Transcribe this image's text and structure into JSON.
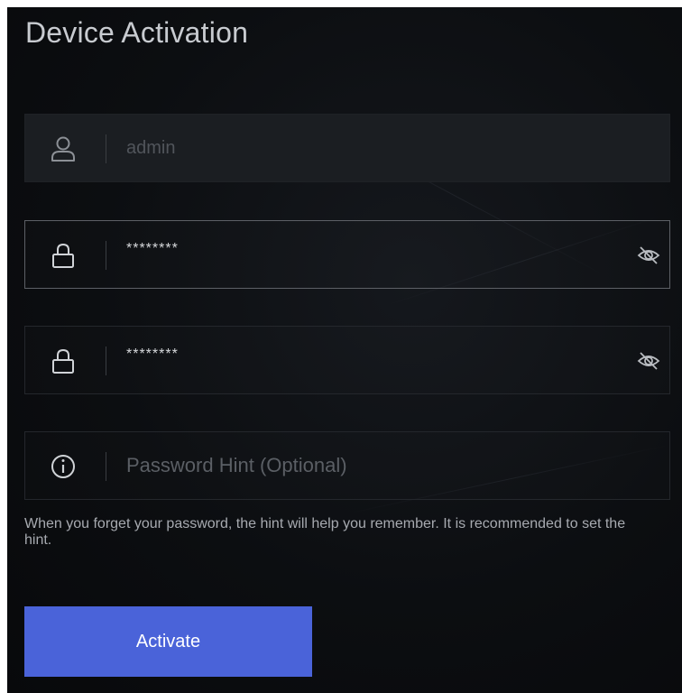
{
  "title": "Device Activation",
  "fields": {
    "username": {
      "value": "admin",
      "icon": "user-icon"
    },
    "password": {
      "value": "********",
      "icon": "lock-icon",
      "toggle_icon": "eye-off-icon"
    },
    "confirm_password": {
      "value": "********",
      "icon": "lock-icon",
      "toggle_icon": "eye-off-icon"
    },
    "hint": {
      "placeholder": "Password Hint (Optional)",
      "icon": "info-icon"
    }
  },
  "hint_help": "When you forget your password, the hint will help you remember. It is recommended to set the hint.",
  "activate_label": "Activate",
  "colors": {
    "background": "#0c0e11",
    "button": "#4a63d9",
    "title": "#c8cbd0"
  }
}
